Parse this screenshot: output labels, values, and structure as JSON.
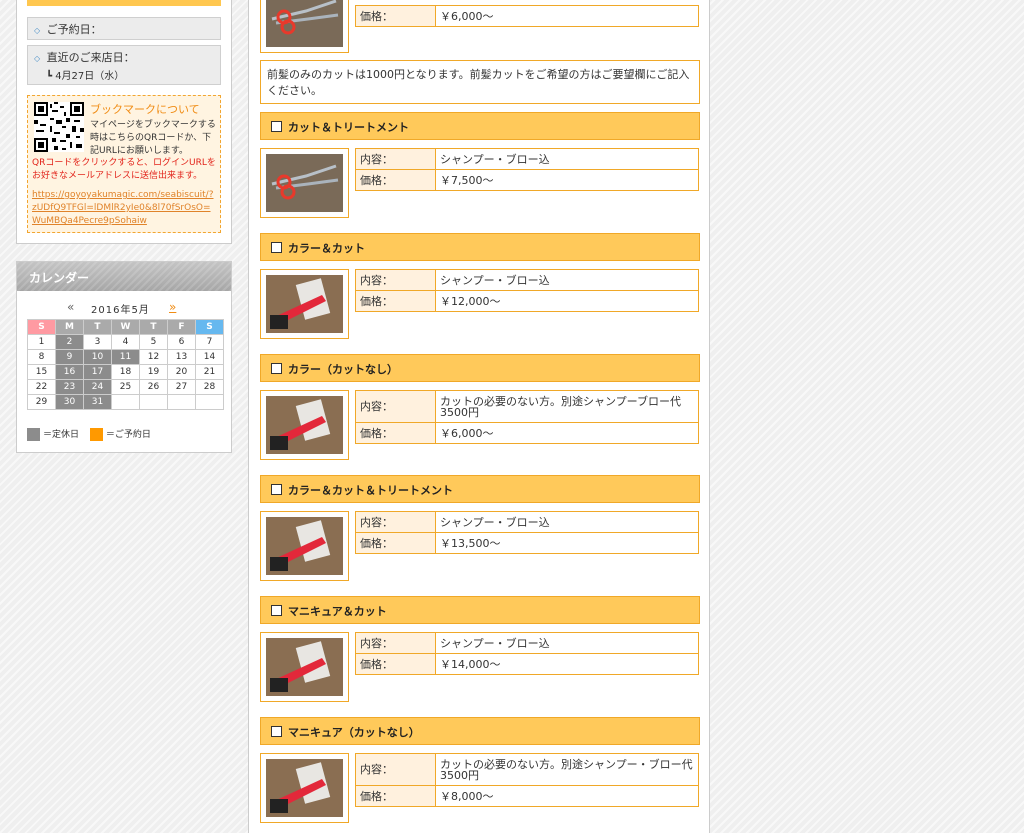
{
  "sidebar": {
    "reservation_date_label": "ご予約日：",
    "last_visit_label": "直近のご来店日：",
    "last_visit_date": "┗ 4月27日（水）",
    "bookmark": {
      "title": "ブックマークについて",
      "description": "マイページをブックマークする時はこちらのQRコードか、下記URLにお願いします。",
      "note": "QRコードをクリックすると、ログインURLをお好きなメールアドレスに送信出来ます。",
      "url": "https://goyoyakumagic.com/seabiscuit/?zUDfQ9TFGl=lDMlR2yIe0&8l70fSrOsO=WuMBQa4Pecre9pSohaiw"
    },
    "calendar": {
      "heading": "カレンダー",
      "prev": "«",
      "month": "2016年5月",
      "next": "»",
      "weekdays": [
        "S",
        "M",
        "T",
        "W",
        "T",
        "F",
        "S"
      ],
      "weeks": [
        [
          "1",
          "2",
          "3",
          "4",
          "5",
          "6",
          "7"
        ],
        [
          "8",
          "9",
          "10",
          "11",
          "12",
          "13",
          "14"
        ],
        [
          "15",
          "16",
          "17",
          "18",
          "19",
          "20",
          "21"
        ],
        [
          "22",
          "23",
          "24",
          "25",
          "26",
          "27",
          "28"
        ],
        [
          "29",
          "30",
          "31",
          "",
          "",
          "",
          ""
        ]
      ],
      "closed_days": [
        "2",
        "9",
        "10",
        "11",
        "16",
        "17",
        "23",
        "24",
        "30",
        "31"
      ],
      "legend_closed": "＝定休日",
      "legend_reserved": "＝ご予約日",
      "legend_closed_color": "#8c8c8c",
      "legend_reserved_color": "#ff9900"
    }
  },
  "main": {
    "top_item": {
      "price_label": "価格：",
      "price": "￥6,000〜"
    },
    "note": "前髪のみのカットは1000円となります。前髪カットをご希望の方はご要望欄にご記入ください。",
    "menus": [
      {
        "title": "カット＆トリートメント",
        "image": "scissors",
        "content_label": "内容：",
        "content": "シャンプー・ブロー込",
        "price_label": "価格：",
        "price": "￥7,500〜"
      },
      {
        "title": "カラー＆カット",
        "image": "colorkit",
        "content_label": "内容：",
        "content": "シャンプー・ブロー込",
        "price_label": "価格：",
        "price": "￥12,000〜"
      },
      {
        "title": "カラー（カットなし）",
        "image": "colorkit",
        "content_label": "内容：",
        "content": "カットの必要のない方。別途シャンプーブロー代3500円",
        "price_label": "価格：",
        "price": "￥6,000〜"
      },
      {
        "title": "カラー＆カット＆トリートメント",
        "image": "colorkit",
        "content_label": "内容：",
        "content": "シャンプー・ブロー込",
        "price_label": "価格：",
        "price": "￥13,500〜"
      },
      {
        "title": "マニキュア＆カット",
        "image": "colorkit",
        "content_label": "内容：",
        "content": "シャンプー・ブロー込",
        "price_label": "価格：",
        "price": "￥14,000〜"
      },
      {
        "title": "マニキュア（カットなし）",
        "image": "colorkit",
        "content_label": "内容：",
        "content": "カットの必要のない方。別途シャンプー・ブロー代3500円",
        "price_label": "価格：",
        "price": "￥8,000〜"
      }
    ]
  }
}
